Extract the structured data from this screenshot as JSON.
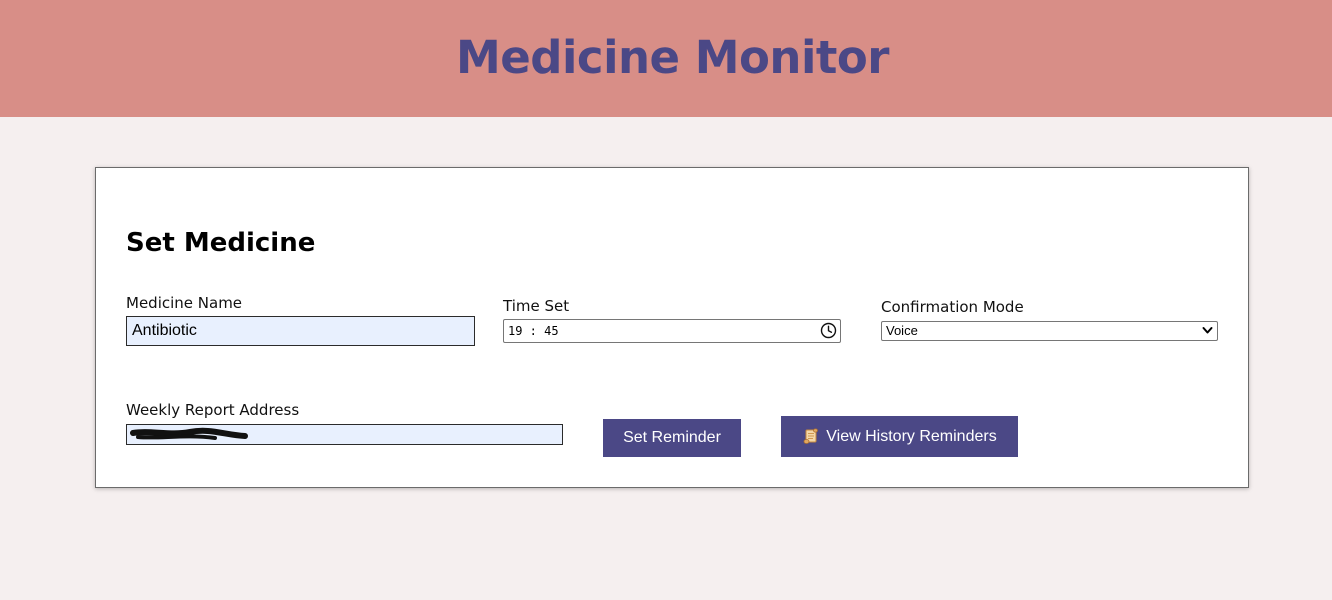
{
  "header": {
    "title": "Medicine Monitor",
    "background_color": "#d88e87",
    "title_color": "#4b4886"
  },
  "form": {
    "title": "Set Medicine",
    "medicine_name": {
      "label": "Medicine Name",
      "value": "Antibiotic"
    },
    "time_set": {
      "label": "Time Set",
      "value": "19 : 45",
      "icon": "clock-icon"
    },
    "confirmation_mode": {
      "label": "Confirmation Mode",
      "selected": "Voice",
      "icon": "chevron-down-icon"
    },
    "weekly_report": {
      "label": "Weekly Report Address",
      "value_redacted": true
    },
    "buttons": {
      "set_reminder": "Set Reminder",
      "view_history": "View History Reminders",
      "view_history_icon": "scroll-icon",
      "button_color": "#4b4886"
    }
  }
}
